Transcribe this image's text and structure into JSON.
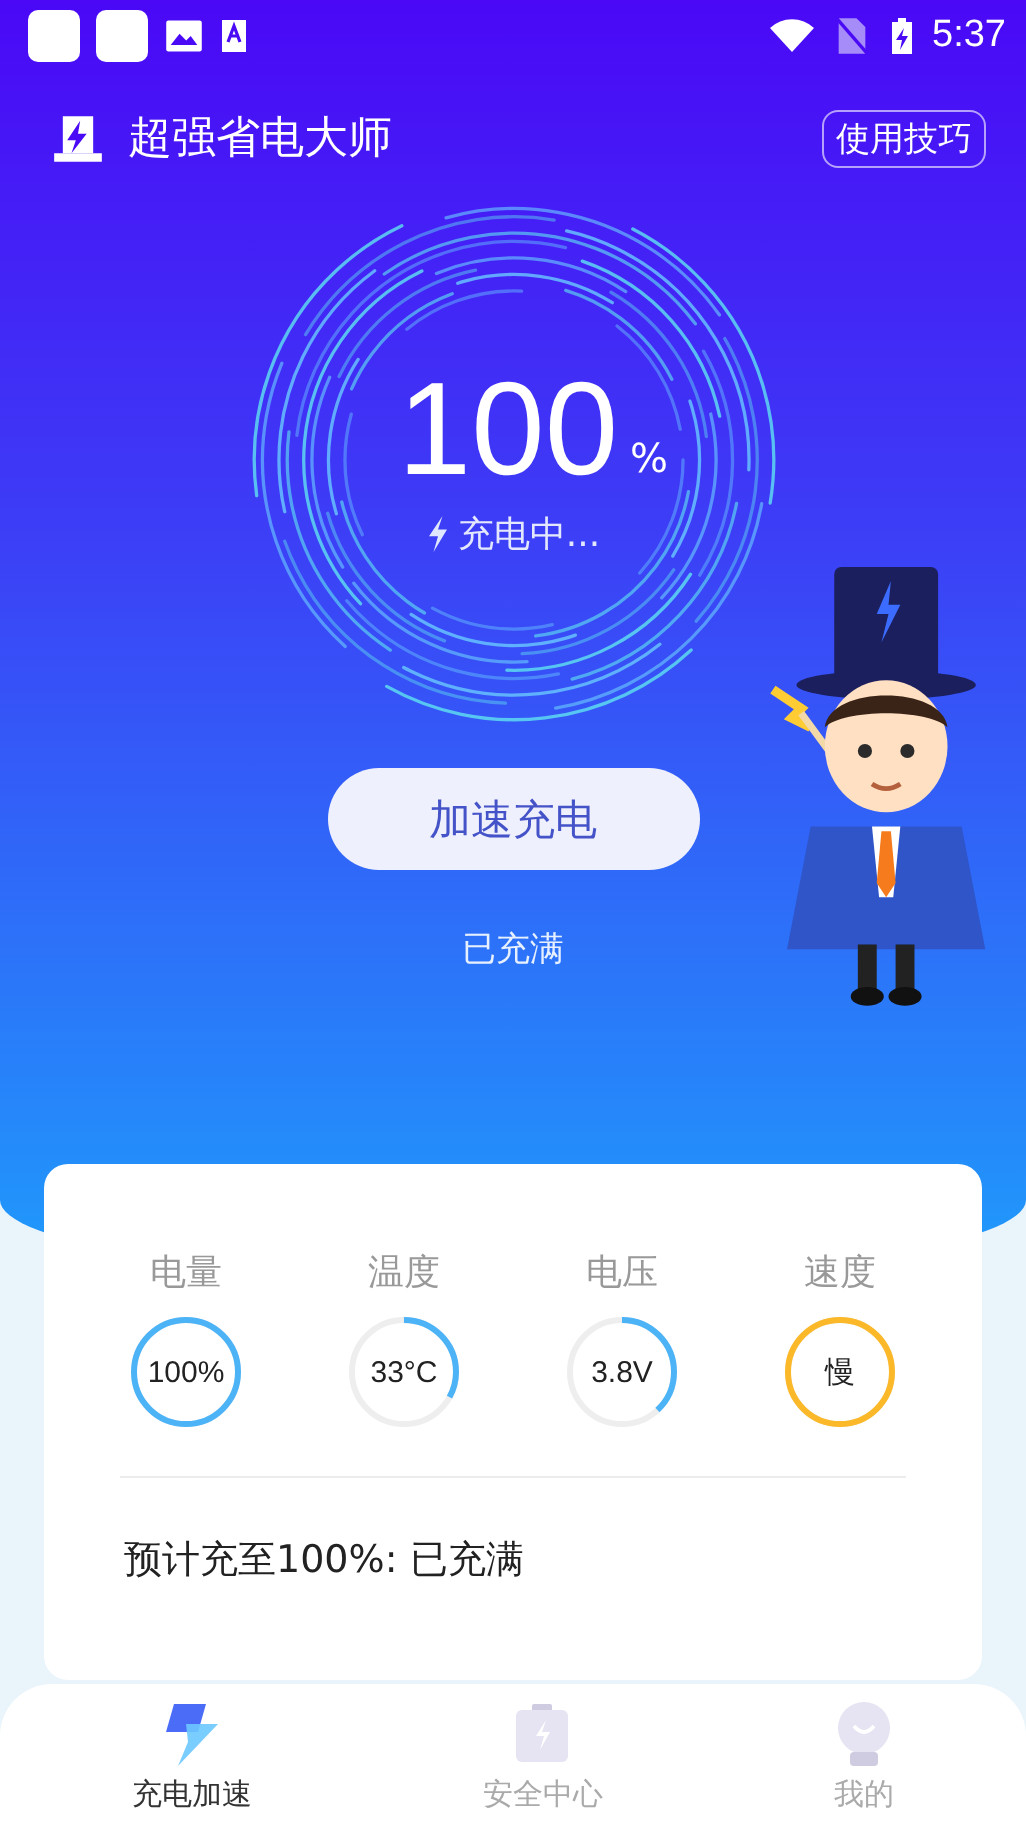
{
  "status_bar": {
    "time": "5:37"
  },
  "header": {
    "title": "超强省电大师",
    "tips_button": "使用技巧"
  },
  "gauge": {
    "percent": "100",
    "unit": "%",
    "status": "充电中..."
  },
  "boost_button": "加速充电",
  "charge_state": "已充满",
  "stats": [
    {
      "label": "电量",
      "value": "100%",
      "level": 1,
      "color": "#4db3f7"
    },
    {
      "label": "温度",
      "value": "33°C",
      "level": 0.33,
      "color": "#4db3f7"
    },
    {
      "label": "电压",
      "value": "3.8V",
      "level": 0.38,
      "color": "#4db3f7"
    },
    {
      "label": "速度",
      "value": "慢",
      "level": 1,
      "color": "#fbb829"
    }
  ],
  "estimate": "预计充至100%: 已充满",
  "tabs": [
    {
      "label": "充电加速",
      "kind": "bolt",
      "selected": true
    },
    {
      "label": "安全中心",
      "kind": "battery",
      "selected": false
    },
    {
      "label": "我的",
      "kind": "bulb",
      "selected": false
    }
  ]
}
